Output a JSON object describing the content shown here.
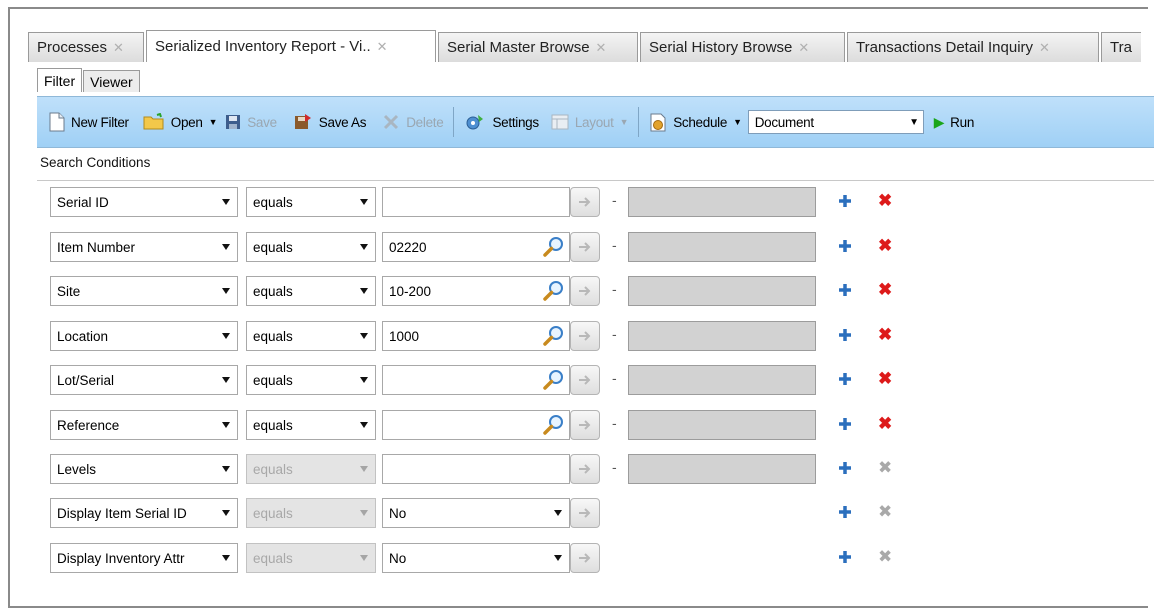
{
  "doc_tabs": [
    {
      "label": "Processes",
      "active": false
    },
    {
      "label": "Serialized Inventory Report - Vi..",
      "active": true
    },
    {
      "label": "Serial Master Browse",
      "active": false
    },
    {
      "label": "Serial History Browse",
      "active": false
    },
    {
      "label": "Transactions Detail Inquiry",
      "active": false
    },
    {
      "label": "Tra",
      "active": false
    }
  ],
  "sub_tabs": [
    {
      "label": "Filter",
      "active": true
    },
    {
      "label": "Viewer",
      "active": false
    }
  ],
  "toolbar": {
    "new_filter": "New Filter",
    "open": "Open",
    "save": "Save",
    "save_as": "Save As",
    "delete": "Delete",
    "settings": "Settings",
    "layout": "Layout",
    "schedule": "Schedule",
    "output_format": "Document",
    "run": "Run"
  },
  "search_conditions_label": "Search Conditions",
  "conditions": [
    {
      "field": "Serial ID",
      "operator": "equals",
      "operator_enabled": true,
      "value": "",
      "lookup": false,
      "range": true,
      "delete_enabled": true
    },
    {
      "field": "Item Number",
      "operator": "equals",
      "operator_enabled": true,
      "value": "02220",
      "lookup": true,
      "range": true,
      "delete_enabled": true
    },
    {
      "field": "Site",
      "operator": "equals",
      "operator_enabled": true,
      "value": "10-200",
      "lookup": true,
      "range": true,
      "delete_enabled": true
    },
    {
      "field": "Location",
      "operator": "equals",
      "operator_enabled": true,
      "value": "1000",
      "lookup": true,
      "range": true,
      "delete_enabled": true
    },
    {
      "field": "Lot/Serial",
      "operator": "equals",
      "operator_enabled": true,
      "value": "",
      "lookup": true,
      "range": true,
      "delete_enabled": true
    },
    {
      "field": "Reference",
      "operator": "equals",
      "operator_enabled": true,
      "value": "",
      "lookup": true,
      "range": true,
      "delete_enabled": true
    },
    {
      "field": "Levels",
      "operator": "equals",
      "operator_enabled": false,
      "value": "",
      "lookup": false,
      "range": true,
      "delete_enabled": false
    },
    {
      "field": "Display Item Serial ID",
      "operator": "equals",
      "operator_enabled": false,
      "value": "No",
      "lookup": false,
      "range": false,
      "dropdown_value": true,
      "delete_enabled": false
    },
    {
      "field": "Display Inventory Attr",
      "operator": "equals",
      "operator_enabled": false,
      "value": "No",
      "lookup": false,
      "range": false,
      "dropdown_value": true,
      "delete_enabled": false
    }
  ],
  "colors": {
    "toolbar_top": "#bfe0fa",
    "toolbar_bottom": "#9fd0f5",
    "add_icon": "#2b6fbd",
    "delete_icon": "#dd1a1a",
    "disabled": "#a9a9a9"
  }
}
